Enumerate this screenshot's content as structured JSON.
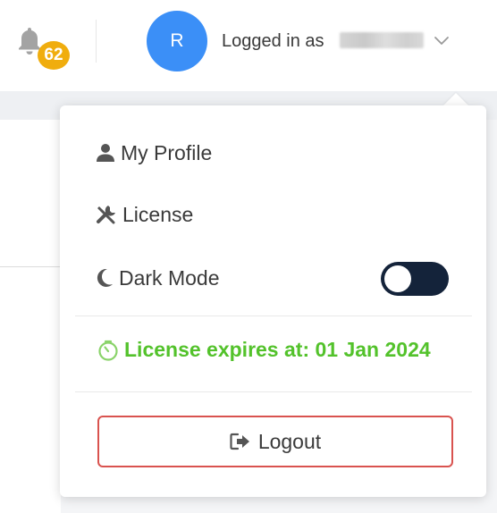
{
  "header": {
    "notification_count": "62",
    "avatar_initial": "R",
    "logged_in_label": "Logged in as"
  },
  "menu": {
    "profile_label": "My Profile",
    "license_label": "License",
    "dark_mode_label": "Dark Mode",
    "dark_mode_enabled": false,
    "license_expiry": "License expires at: 01 Jan 2024",
    "logout_label": "Logout"
  },
  "colors": {
    "avatar_bg": "#3b8ff7",
    "badge_bg": "#f0ad0e",
    "expiry_green": "#53c22b",
    "logout_border": "#d9534f",
    "toggle_bg": "#14233a"
  },
  "icons": {
    "bell": "bell-icon",
    "chevron": "chevron-down-icon",
    "profile": "user-icon",
    "license": "tools-icon",
    "dark_mode": "moon-icon",
    "expiry": "timer-icon",
    "logout": "sign-out-icon"
  }
}
